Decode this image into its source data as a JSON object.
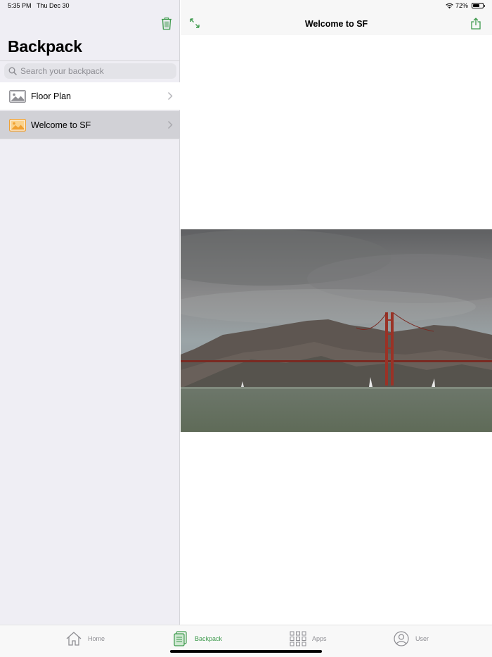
{
  "status_bar": {
    "time": "5:35 PM",
    "date": "Thu Dec 30",
    "battery_text": "72%",
    "battery_level": 0.72
  },
  "sidebar": {
    "title": "Backpack",
    "search_placeholder": "Search your backpack",
    "search_value": "",
    "items": [
      {
        "label": "Floor Plan",
        "icon": "image-icon",
        "selected": false
      },
      {
        "label": "Welcome to SF",
        "icon": "image-icon",
        "selected": true
      }
    ]
  },
  "main": {
    "title": "Welcome to SF"
  },
  "tabbar": {
    "tabs": [
      {
        "label": "Home",
        "icon": "home-icon",
        "active": false
      },
      {
        "label": "Backpack",
        "icon": "backpack-icon",
        "active": true
      },
      {
        "label": "Apps",
        "icon": "apps-grid-icon",
        "active": false
      },
      {
        "label": "User",
        "icon": "user-icon",
        "active": false
      }
    ]
  },
  "colors": {
    "accent": "#3d9a4c",
    "selected_thumb": "#f0a030",
    "sidebar_bg": "#efeef4",
    "selected_row": "#d1d1d6"
  }
}
